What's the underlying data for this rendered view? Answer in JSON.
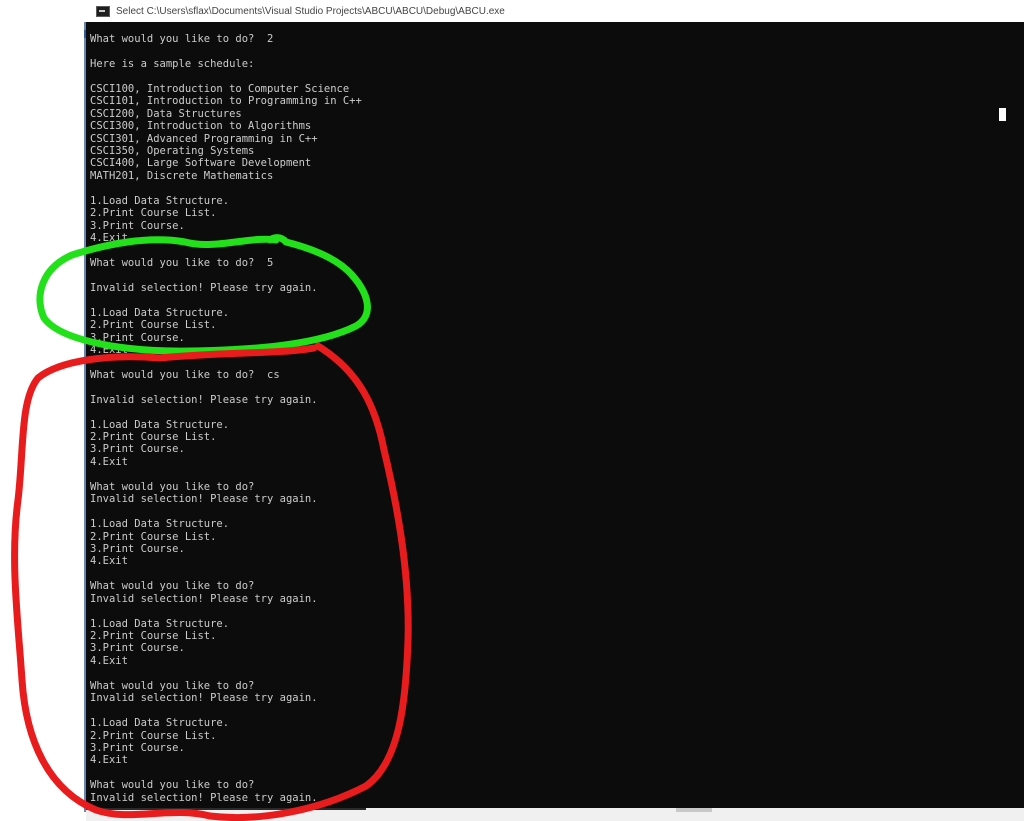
{
  "window": {
    "title": "Select C:\\Users\\sflax\\Documents\\Visual Studio Projects\\ABCU\\ABCU\\Debug\\ABCU.exe",
    "icon": "console-app-icon"
  },
  "console": {
    "lines": [
      "What would you like to do?  2",
      "",
      "Here is a sample schedule:",
      "",
      "CSCI100, Introduction to Computer Science",
      "CSCI101, Introduction to Programming in C++",
      "CSCI200, Data Structures",
      "CSCI300, Introduction to Algorithms",
      "CSCI301, Advanced Programming in C++",
      "CSCI350, Operating Systems",
      "CSCI400, Large Software Development",
      "MATH201, Discrete Mathematics",
      "",
      "1.Load Data Structure.",
      "2.Print Course List.",
      "3.Print Course.",
      "4.Exit",
      "",
      "What would you like to do?  5",
      "",
      "Invalid selection! Please try again.",
      "",
      "1.Load Data Structure.",
      "2.Print Course List.",
      "3.Print Course.",
      "4.Exit",
      "",
      "What would you like to do?  cs",
      "",
      "Invalid selection! Please try again.",
      "",
      "1.Load Data Structure.",
      "2.Print Course List.",
      "3.Print Course.",
      "4.Exit",
      "",
      "What would you like to do?",
      "Invalid selection! Please try again.",
      "",
      "1.Load Data Structure.",
      "2.Print Course List.",
      "3.Print Course.",
      "4.Exit",
      "",
      "What would you like to do?",
      "Invalid selection! Please try again.",
      "",
      "1.Load Data Structure.",
      "2.Print Course List.",
      "3.Print Course.",
      "4.Exit",
      "",
      "What would you like to do?",
      "Invalid selection! Please try again.",
      "",
      "1.Load Data Structure.",
      "2.Print Course List.",
      "3.Print Course.",
      "4.Exit",
      "",
      "What would you like to do?",
      "Invalid selection! Please try again."
    ]
  },
  "annotations": {
    "green_color": "#22e01a",
    "red_color": "#e81c1c"
  }
}
